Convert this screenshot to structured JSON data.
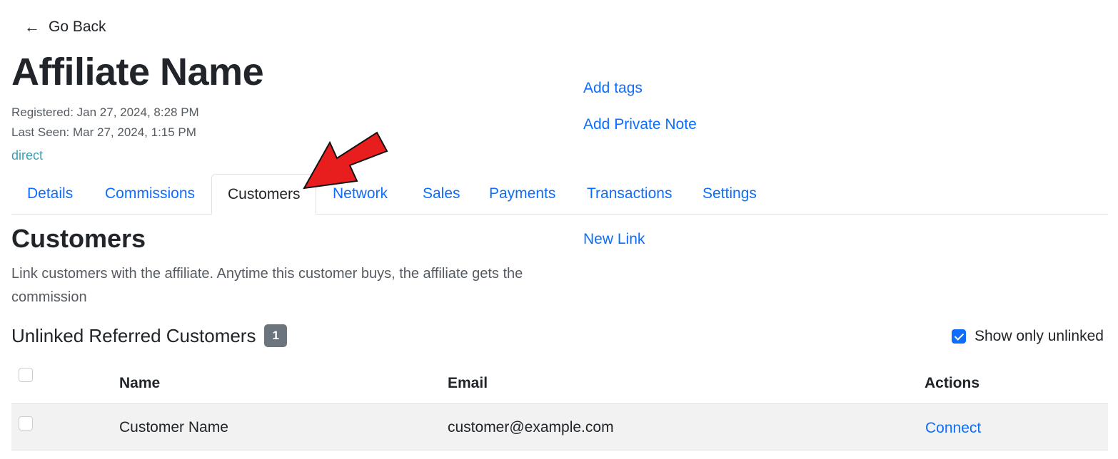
{
  "nav": {
    "back_icon": "←",
    "back_label": "Go Back"
  },
  "affiliate": {
    "name": "Affiliate Name",
    "registered": "Registered: Jan 27, 2024, 8:28 PM",
    "last_seen": "Last Seen: Mar 27, 2024, 1:15 PM",
    "source": "direct"
  },
  "side_actions": {
    "add_tags": "Add tags",
    "add_note": "Add Private Note",
    "new_link": "New Link"
  },
  "tabs": [
    {
      "label": "Details"
    },
    {
      "label": "Commissions"
    },
    {
      "label": "Customers",
      "active": true
    },
    {
      "label": "Network"
    },
    {
      "label": "Sales"
    },
    {
      "label": "Payments"
    },
    {
      "label": "Transactions"
    },
    {
      "label": "Settings"
    }
  ],
  "customers": {
    "title": "Customers",
    "description": "Link customers with the affiliate. Anytime this customer buys, the affiliate gets the commission",
    "unlinked_title": "Unlinked Referred Customers",
    "unlinked_count": "1",
    "show_only_unlinked_label": "Show only unlinked",
    "show_only_unlinked_checked": true,
    "table": {
      "headers": {
        "name": "Name",
        "email": "Email",
        "actions": "Actions"
      },
      "rows": [
        {
          "name": "Customer Name",
          "email": "customer@example.com",
          "action": "Connect"
        }
      ]
    }
  },
  "colors": {
    "link": "#0d6efd",
    "source": "#3a9fb5",
    "badge": "#6c757d",
    "arrow": "#e81e1e"
  }
}
